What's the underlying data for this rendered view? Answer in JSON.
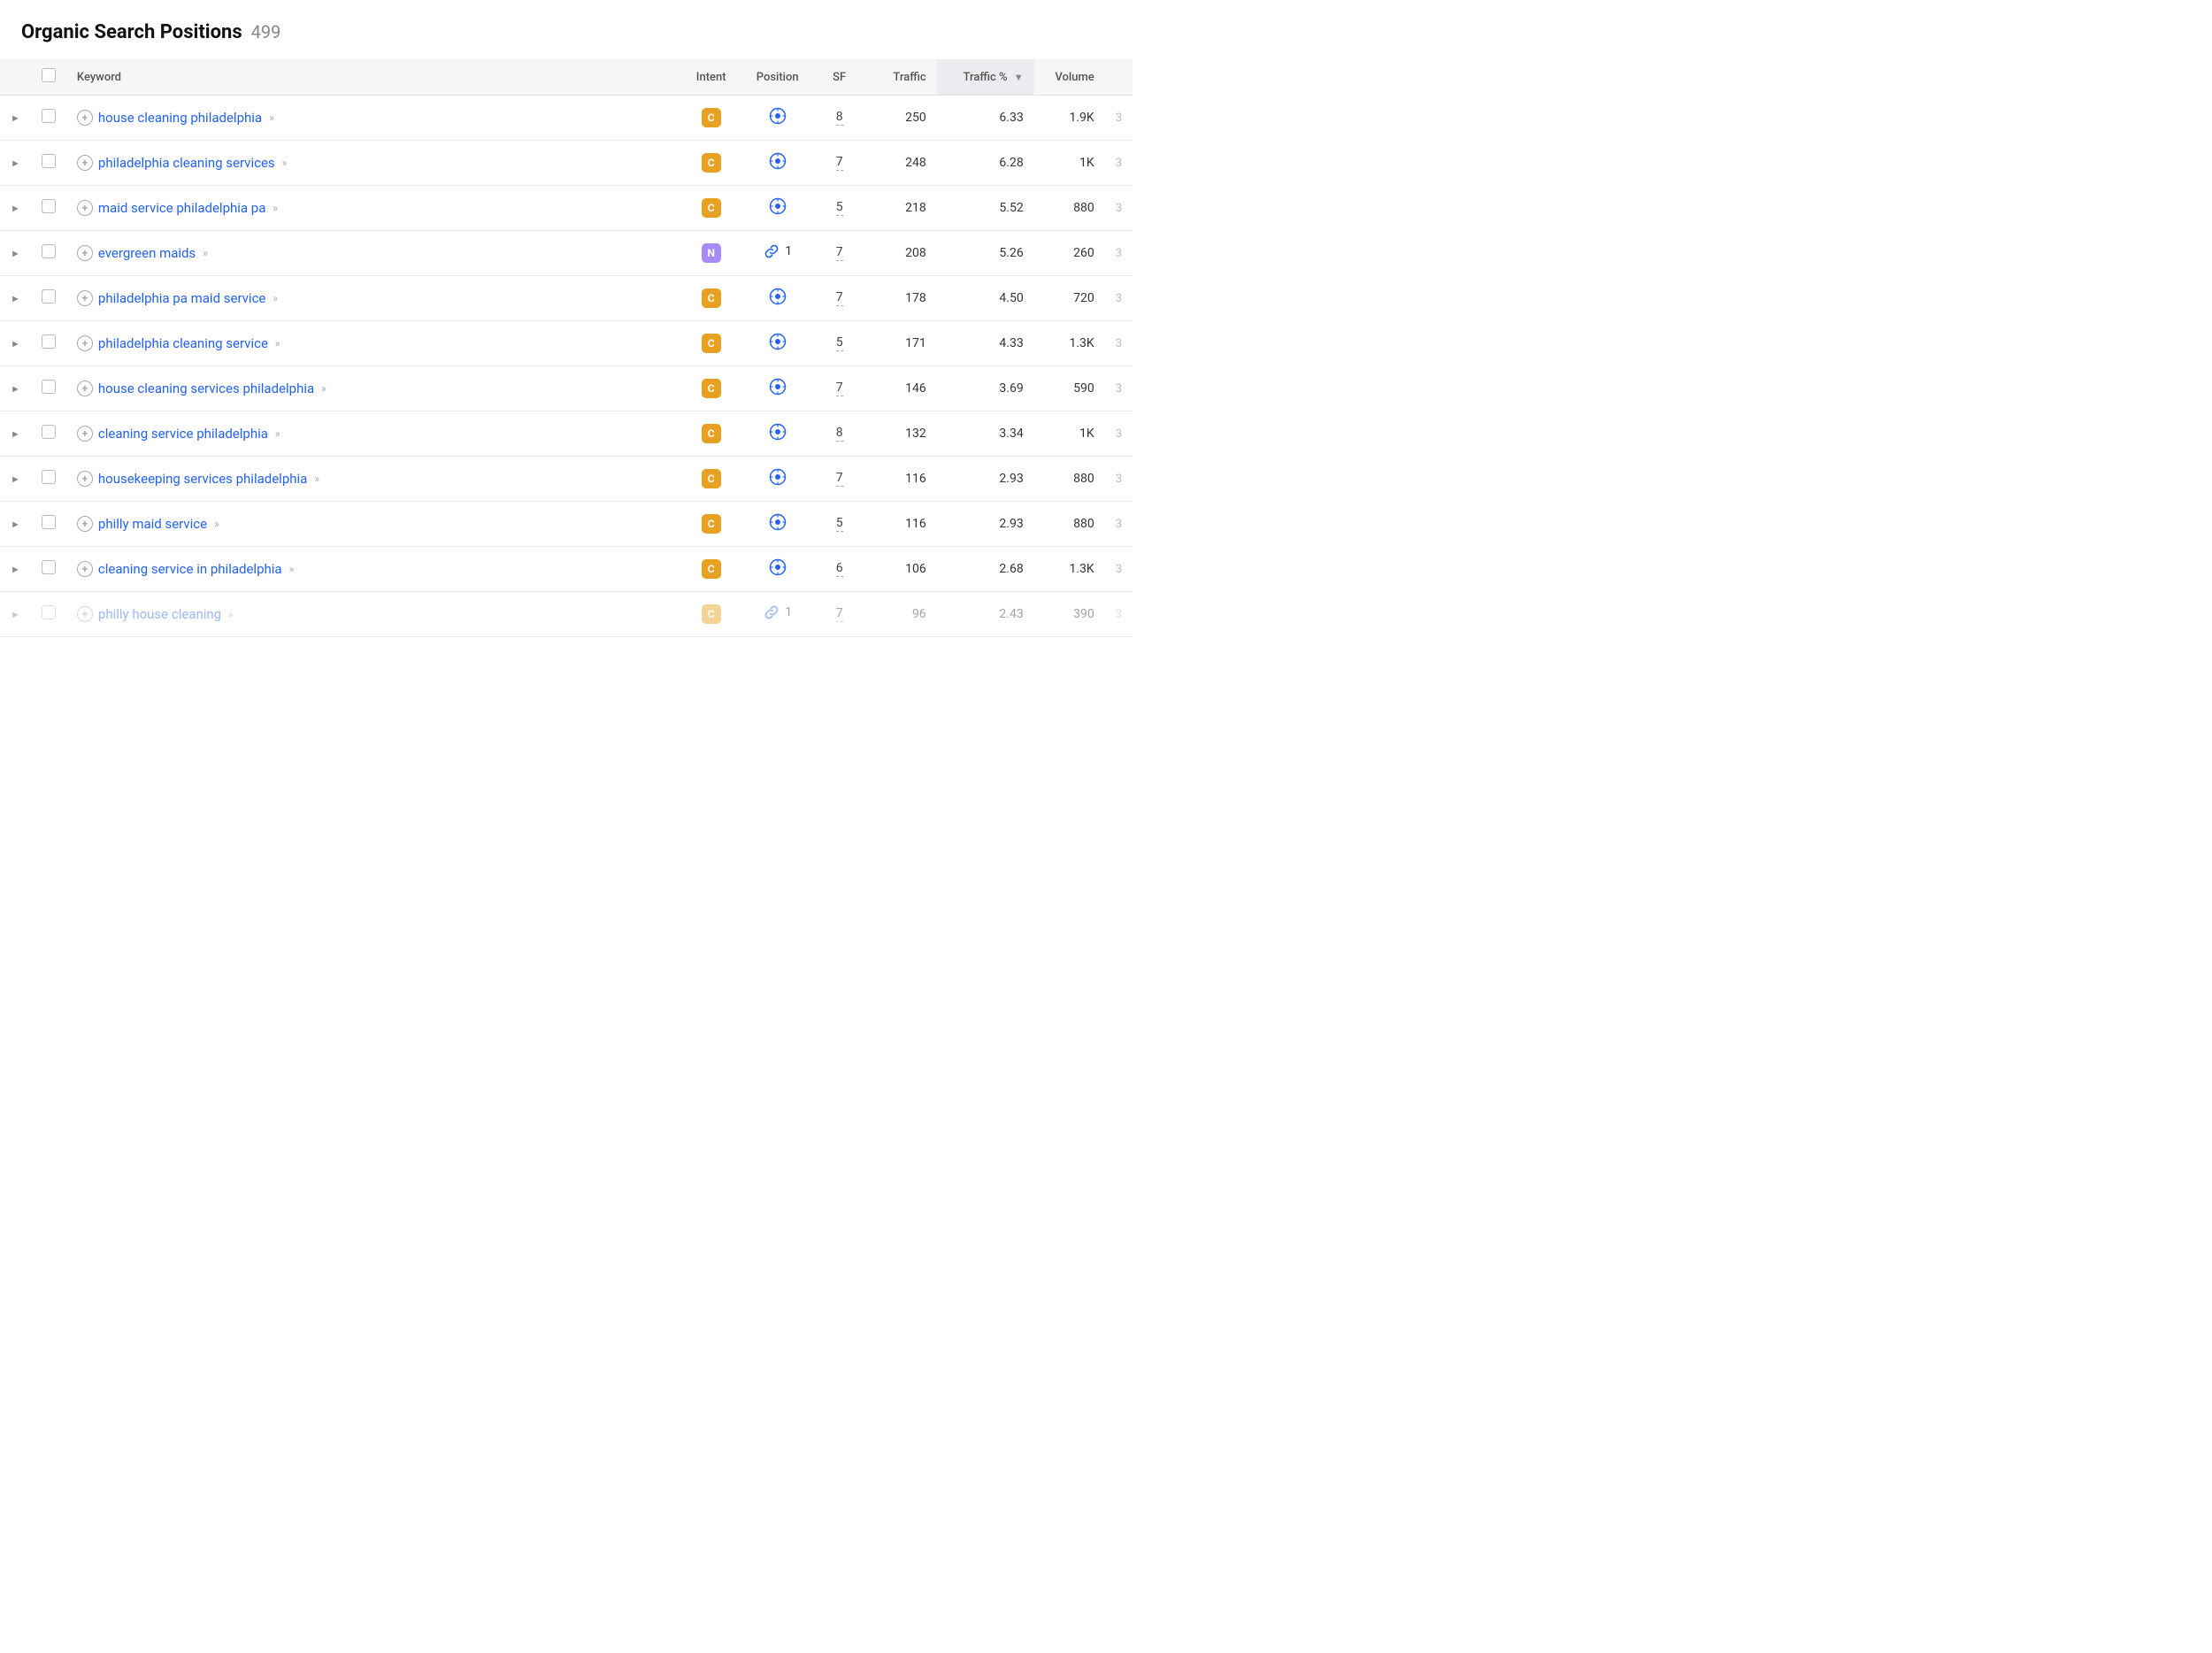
{
  "header": {
    "title": "Organic Search Positions",
    "count": "499"
  },
  "table": {
    "columns": [
      {
        "key": "expand",
        "label": ""
      },
      {
        "key": "check",
        "label": ""
      },
      {
        "key": "keyword",
        "label": "Keyword"
      },
      {
        "key": "intent",
        "label": "Intent"
      },
      {
        "key": "position",
        "label": "Position"
      },
      {
        "key": "sf",
        "label": "SF"
      },
      {
        "key": "traffic",
        "label": "Traffic"
      },
      {
        "key": "traffic_pct",
        "label": "Traffic %",
        "active": true,
        "has_filter": true
      },
      {
        "key": "volume",
        "label": "Volume"
      }
    ],
    "rows": [
      {
        "keyword": "house cleaning philadelphia",
        "intent": "C",
        "position_type": "location",
        "position_num": "",
        "sf": "8",
        "traffic": "250",
        "traffic_pct": "6.33",
        "volume": "1.9K",
        "extra": "3"
      },
      {
        "keyword": "philadelphia cleaning services",
        "intent": "C",
        "position_type": "location",
        "position_num": "",
        "sf": "7",
        "traffic": "248",
        "traffic_pct": "6.28",
        "volume": "1K",
        "extra": "3"
      },
      {
        "keyword": "maid service philadelphia pa",
        "intent": "C",
        "position_type": "location",
        "position_num": "",
        "sf": "5",
        "traffic": "218",
        "traffic_pct": "5.52",
        "volume": "880",
        "extra": "3"
      },
      {
        "keyword": "evergreen maids",
        "intent": "N",
        "position_type": "link",
        "position_num": "1",
        "sf": "7",
        "traffic": "208",
        "traffic_pct": "5.26",
        "volume": "260",
        "extra": "3"
      },
      {
        "keyword": "philadelphia pa maid service",
        "intent": "C",
        "position_type": "location",
        "position_num": "",
        "sf": "7",
        "traffic": "178",
        "traffic_pct": "4.50",
        "volume": "720",
        "extra": "3"
      },
      {
        "keyword": "philadelphia cleaning service",
        "intent": "C",
        "position_type": "location",
        "position_num": "",
        "sf": "5",
        "traffic": "171",
        "traffic_pct": "4.33",
        "volume": "1.3K",
        "extra": "3"
      },
      {
        "keyword": "house cleaning services philadelphia",
        "intent": "C",
        "position_type": "location",
        "position_num": "",
        "sf": "7",
        "traffic": "146",
        "traffic_pct": "3.69",
        "volume": "590",
        "extra": "3"
      },
      {
        "keyword": "cleaning service philadelphia",
        "intent": "C",
        "position_type": "location",
        "position_num": "",
        "sf": "8",
        "traffic": "132",
        "traffic_pct": "3.34",
        "volume": "1K",
        "extra": "3"
      },
      {
        "keyword": "housekeeping services philadelphia",
        "intent": "C",
        "position_type": "location",
        "position_num": "",
        "sf": "7",
        "traffic": "116",
        "traffic_pct": "2.93",
        "volume": "880",
        "extra": "3"
      },
      {
        "keyword": "philly maid service",
        "intent": "C",
        "position_type": "location",
        "position_num": "",
        "sf": "5",
        "traffic": "116",
        "traffic_pct": "2.93",
        "volume": "880",
        "extra": "3"
      },
      {
        "keyword": "cleaning service in philadelphia",
        "intent": "C",
        "position_type": "location",
        "position_num": "",
        "sf": "6",
        "traffic": "106",
        "traffic_pct": "2.68",
        "volume": "1.3K",
        "extra": "3"
      },
      {
        "keyword": "philly house cleaning",
        "intent": "C",
        "position_type": "link",
        "position_num": "1",
        "sf": "7",
        "traffic": "96",
        "traffic_pct": "2.43",
        "volume": "390",
        "extra": "3",
        "faded": true
      }
    ]
  }
}
